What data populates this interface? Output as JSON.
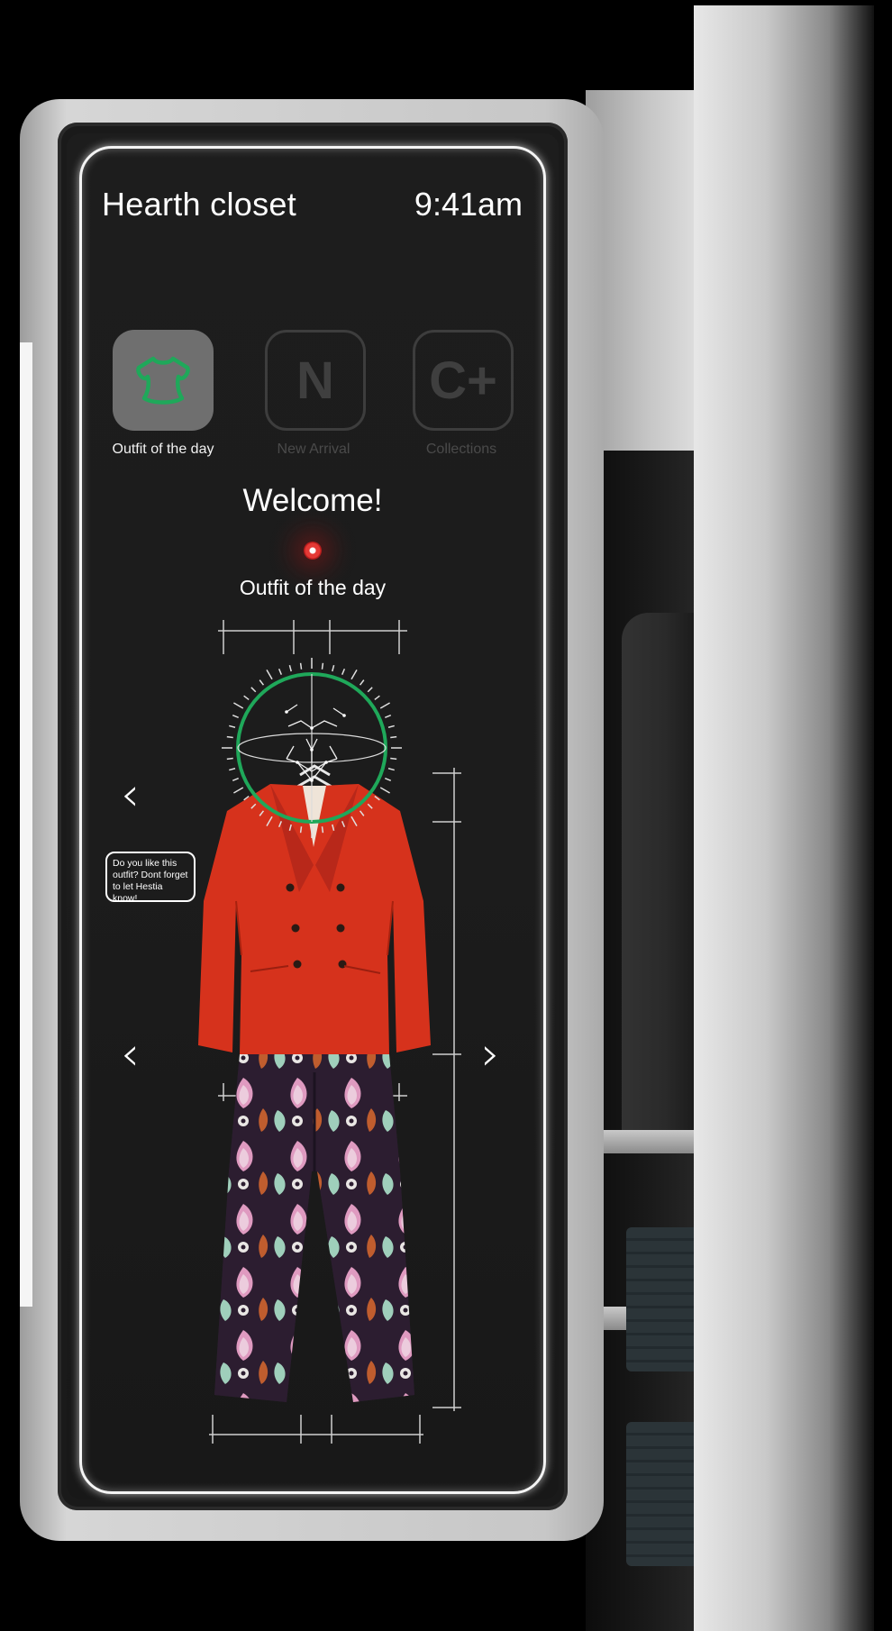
{
  "app": {
    "title": "Hearth closet",
    "time": "9:41am"
  },
  "menu": {
    "tiles": [
      {
        "label": "Outfit of the day",
        "icon": "shirt-icon",
        "active": true
      },
      {
        "label": "New Arrival",
        "icon": "letter-n-icon",
        "glyph": "N",
        "active": false
      },
      {
        "label": "Collections",
        "icon": "letter-c-plus-icon",
        "glyph": "C+",
        "active": false
      }
    ]
  },
  "main": {
    "welcome": "Welcome!",
    "subtitle": "Outfit of the day",
    "tip": "Do you like this outfit? Dont forget to let Hestia know!"
  },
  "colors": {
    "accent_green": "#1f9d55",
    "jacket_red": "#d6321c",
    "record_red": "#e53935",
    "screen_bg": "#1c1c1c",
    "glow_white": "#f4f4f4"
  }
}
